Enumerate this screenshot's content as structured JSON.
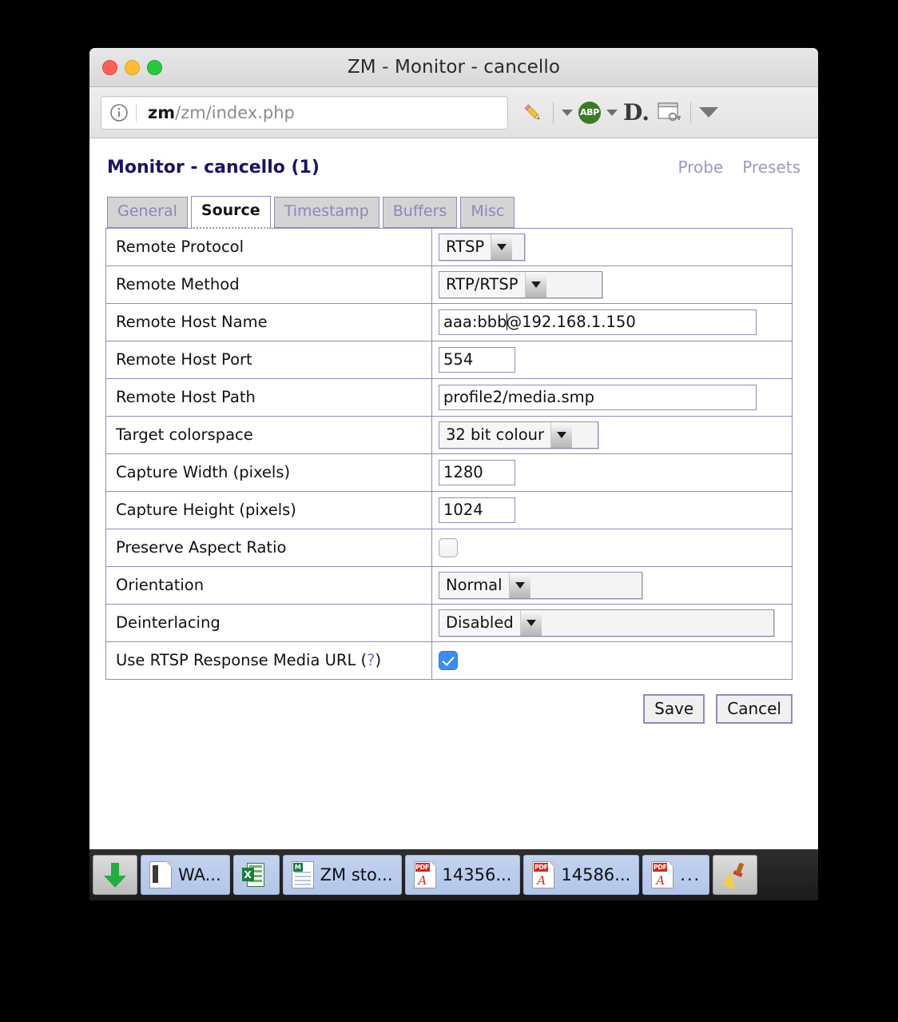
{
  "window": {
    "title": "ZM - Monitor - cancello",
    "traffic_lights": [
      "close",
      "minimize",
      "maximize"
    ]
  },
  "toolbar": {
    "url_host": "zm",
    "url_path": "/zm/index.php",
    "icons": [
      "info-icon",
      "pencil-icon",
      "chevron-down-icon",
      "abp-icon",
      "chevron-down-icon",
      "disconnect-icon",
      "window-key-icon",
      "chevron-down-icon"
    ],
    "abp_label": "ABP",
    "disconnect_label": "D."
  },
  "page": {
    "title": "Monitor - cancello (1)",
    "links": [
      {
        "label": "Probe",
        "name": "probe-link"
      },
      {
        "label": "Presets",
        "name": "presets-link"
      }
    ],
    "tabs": [
      {
        "label": "General",
        "active": false
      },
      {
        "label": "Source",
        "active": true
      },
      {
        "label": "Timestamp",
        "active": false
      },
      {
        "label": "Buffers",
        "active": false
      },
      {
        "label": "Misc",
        "active": false
      }
    ],
    "fields": {
      "remote_protocol": {
        "label": "Remote Protocol",
        "value": "RTSP"
      },
      "remote_method": {
        "label": "Remote Method",
        "value": "RTP/RTSP"
      },
      "remote_host_name": {
        "label": "Remote Host Name",
        "value_before_caret": "aaa:bbb",
        "value_after_caret": "@192.168.1.150"
      },
      "remote_host_port": {
        "label": "Remote Host Port",
        "value": "554"
      },
      "remote_host_path": {
        "label": "Remote Host Path",
        "value": "profile2/media.smp"
      },
      "target_colorspace": {
        "label": "Target colorspace",
        "value": "32 bit colour"
      },
      "capture_width": {
        "label": "Capture Width (pixels)",
        "value": "1280"
      },
      "capture_height": {
        "label": "Capture Height (pixels)",
        "value": "1024"
      },
      "preserve_aspect_ratio": {
        "label": "Preserve Aspect Ratio",
        "checked": false
      },
      "orientation": {
        "label": "Orientation",
        "value": "Normal"
      },
      "deinterlacing": {
        "label": "Deinterlacing",
        "value": "Disabled"
      },
      "use_rtsp_media_url": {
        "label": "Use RTSP Response Media URL (",
        "help": "?",
        "label_end": ")",
        "checked": true
      }
    },
    "buttons": {
      "save": "Save",
      "cancel": "Cancel"
    }
  },
  "taskbar": {
    "items": [
      {
        "name": "downloads-button",
        "icon": "download-arrow-icon",
        "label": ""
      },
      {
        "name": "taskbar-item-word",
        "icon": "word-doc-icon",
        "label": "WA..."
      },
      {
        "name": "taskbar-item-excel",
        "icon": "excel-icon",
        "label": ""
      },
      {
        "name": "taskbar-item-zm-storage",
        "icon": "spreadsheet-icon",
        "label": "ZM sto..."
      },
      {
        "name": "taskbar-item-pdf-14356",
        "icon": "pdf-icon",
        "label": "14356..."
      },
      {
        "name": "taskbar-item-pdf-14586",
        "icon": "pdf-icon",
        "label": "14586..."
      },
      {
        "name": "taskbar-item-pdf-other",
        "icon": "pdf-icon",
        "label": "..."
      },
      {
        "name": "cleanup-button",
        "icon": "broom-icon",
        "label": ""
      }
    ]
  },
  "colors": {
    "table_border": "#8d8dbe",
    "title_link": "#9a9ac8",
    "page_title": "#1b1464",
    "checkbox_on": "#3b8cf4"
  }
}
